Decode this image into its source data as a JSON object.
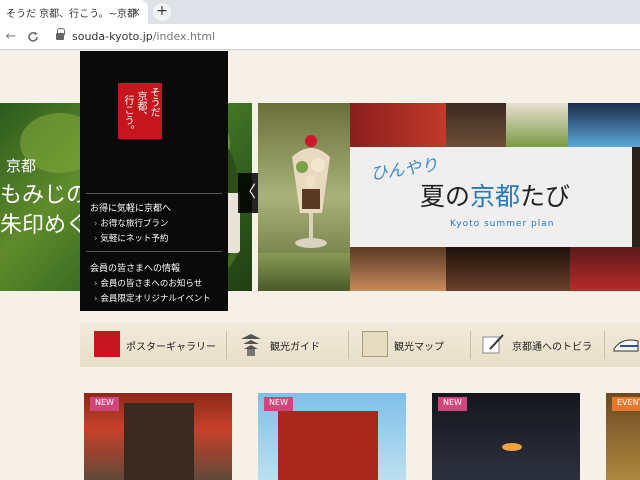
{
  "browser": {
    "tab_title": "そうだ 京都、行こう。~京都",
    "tab_close": "×",
    "new_tab": "+",
    "back": "←",
    "reload": "C",
    "url_host": "souda-kyoto.jp",
    "url_path": "/index.html"
  },
  "menu": {
    "logo_lines": [
      "そうだ",
      "京都、",
      "行こう。"
    ],
    "section1_title": "お得に気軽に京都へ",
    "section1_items": [
      "お得な旅行プラン",
      "気軽にネット予約"
    ],
    "section2_title": "会員の皆さまへの情報",
    "section2_items": [
      "会員の皆さまへのお知らせ",
      "会員限定オリジナルイベント"
    ]
  },
  "hero_left": {
    "line1": "京都",
    "line2": "もみじの名",
    "line3": "朱印めぐり"
  },
  "hero_main": {
    "title_small": "ひんやり",
    "title_part1": "夏の",
    "title_blue": "京都",
    "title_part2": "たび",
    "subtitle": "Kyoto summer plan"
  },
  "slider": {
    "prev": "〈"
  },
  "categories": [
    "ポスターギャラリー",
    "観光ガイド",
    "観光マップ",
    "京都通へのトビラ"
  ],
  "cards": [
    {
      "badge": "NEW"
    },
    {
      "badge": "NEW"
    },
    {
      "badge": "NEW"
    },
    {
      "badge": "EVENT"
    }
  ],
  "colors": {
    "brand_red": "#c4161c",
    "accent_blue": "#2a79b6",
    "new_badge": "#d0457a",
    "event_badge": "#e3782e"
  }
}
